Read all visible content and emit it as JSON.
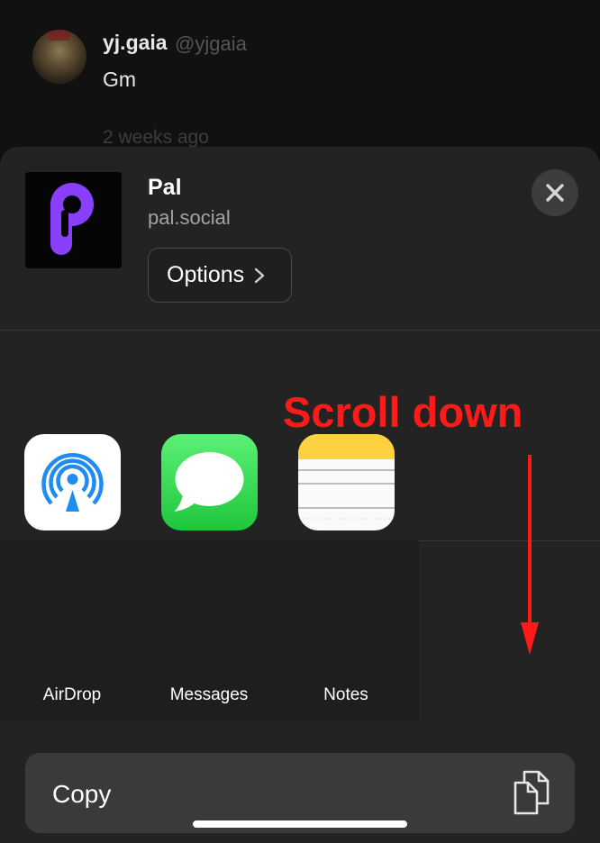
{
  "background_post": {
    "author_name": "yj.gaia",
    "author_handle": "@yjgaia",
    "text": "Gm",
    "timestamp": "2 weeks ago"
  },
  "share_sheet": {
    "app_title": "Pal",
    "app_url": "pal.social",
    "options_label": "Options",
    "close_icon": "close-icon",
    "apps": [
      {
        "label": "AirDrop",
        "icon": "airdrop-icon"
      },
      {
        "label": "Messages",
        "icon": "messages-icon"
      },
      {
        "label": "Notes",
        "icon": "notes-icon"
      }
    ],
    "copy_label": "Copy",
    "copy_icon": "copy-icon"
  },
  "annotation": {
    "text": "Scroll down",
    "color": "#ff1a1a"
  },
  "colors": {
    "sheet_bg": "#232323",
    "app_brand": "#8a3ffc"
  }
}
